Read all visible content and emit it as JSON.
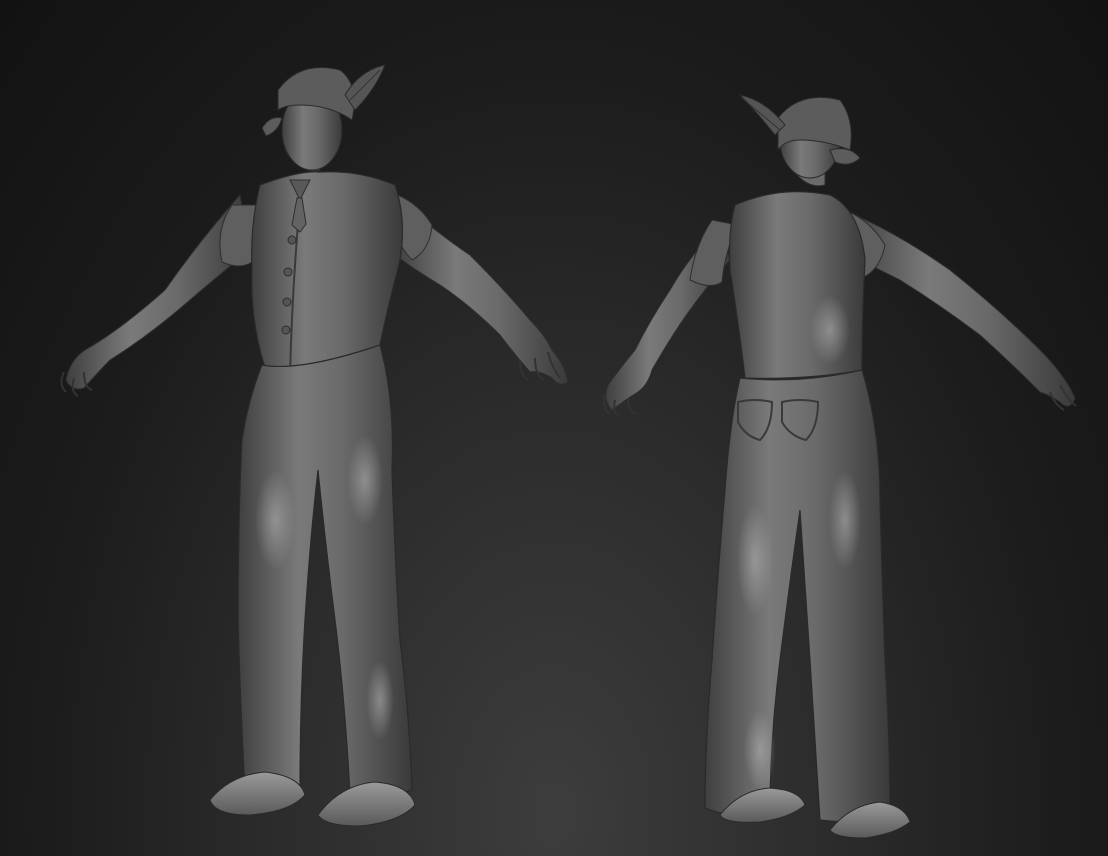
{
  "scene": {
    "background_top": "#121212",
    "background_bottom": "#3d3d3d",
    "material_color": "#6b6b6b",
    "material_shadow": "#2e2e2e",
    "material_highlight": "#a9a9a9"
  },
  "models": [
    {
      "name": "character-front-view",
      "view": "front"
    },
    {
      "name": "character-back-view",
      "view": "back"
    }
  ]
}
